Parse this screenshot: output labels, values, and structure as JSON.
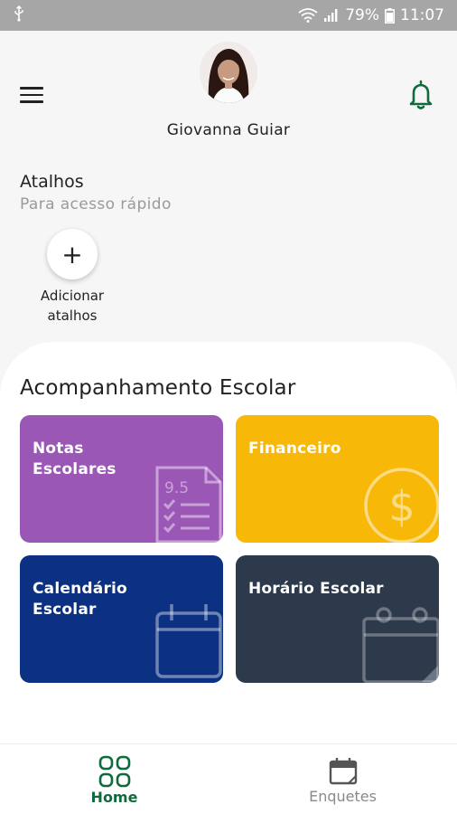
{
  "status_bar": {
    "battery": "79%",
    "time": "11:07"
  },
  "header": {
    "user_name": "Giovanna Guiar",
    "menu_icon": "hamburger-menu-icon",
    "notification_icon": "bell-icon"
  },
  "shortcuts": {
    "title": "Atalhos",
    "subtitle": "Para acesso rápido",
    "add_symbol": "+",
    "add_label": "Adicionar\natalhos"
  },
  "school": {
    "title": "Acompanhamento Escolar",
    "cards": [
      {
        "label": "Notas\nEscolares",
        "color": "#9b57b6",
        "icon": "grades-document-icon",
        "icon_text": "9.5"
      },
      {
        "label": "Financeiro",
        "color": "#f7b808",
        "icon": "dollar-coin-icon",
        "icon_text": "$"
      },
      {
        "label": "Calendário\nEscolar",
        "color": "#0d3182",
        "icon": "calendar-icon"
      },
      {
        "label": "Horário Escolar",
        "color": "#2d3a4b",
        "icon": "schedule-calendar-icon"
      }
    ]
  },
  "bottom_nav": {
    "items": [
      {
        "label": "Home",
        "icon": "home-grid-icon",
        "active": true
      },
      {
        "label": "Enquetes",
        "icon": "polls-calendar-icon",
        "active": false
      }
    ]
  },
  "colors": {
    "accent": "#0d6b3c",
    "inactive": "#8a8a8a",
    "status_bar": "#a6a6a6"
  }
}
